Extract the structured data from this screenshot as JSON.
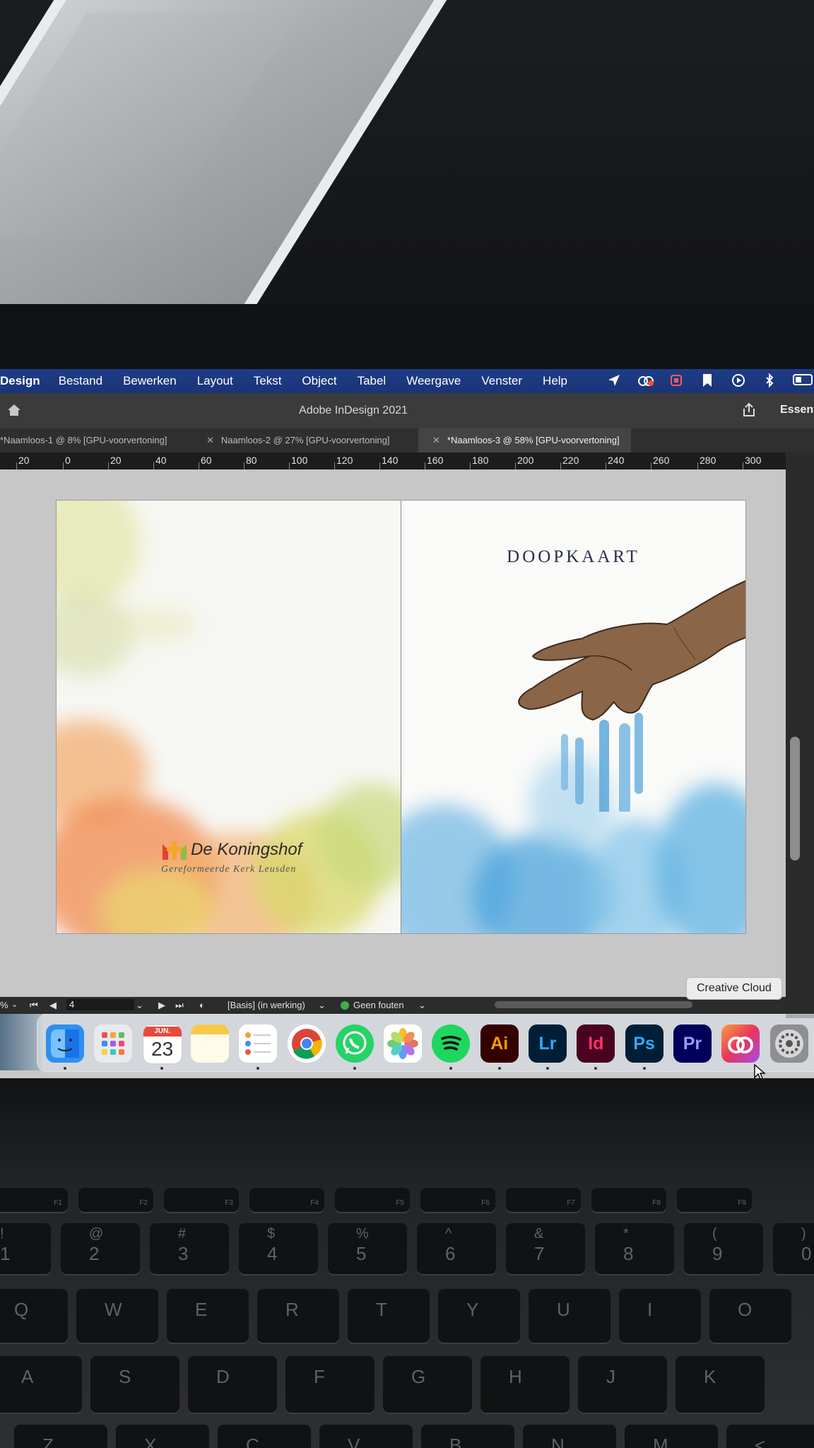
{
  "menubar": {
    "app_name": "Design",
    "items": [
      "Bestand",
      "Bewerken",
      "Layout",
      "Tekst",
      "Object",
      "Tabel",
      "Weergave",
      "Venster",
      "Help"
    ],
    "status_icons": [
      "location-arrow-icon",
      "creative-cloud-status-icon",
      "adobe-updates-icon",
      "bookmark-icon",
      "play-circle-icon",
      "bluetooth-icon",
      "battery-icon"
    ]
  },
  "app_header": {
    "title": "Adobe InDesign 2021",
    "workspace": "Essent"
  },
  "tabs": [
    {
      "label": "*Naamloos-1 @ 8% [GPU-voorvertoning]",
      "active": false
    },
    {
      "label": "Naamloos-2 @ 27% [GPU-voorvertoning]",
      "active": false
    },
    {
      "label": "*Naamloos-3 @ 58% [GPU-voorvertoning]",
      "active": true
    }
  ],
  "ruler": {
    "ticks": [
      "20",
      "0",
      "20",
      "40",
      "60",
      "80",
      "100",
      "120",
      "140",
      "160",
      "180",
      "200",
      "220",
      "240",
      "260",
      "280",
      "300"
    ]
  },
  "document": {
    "right_page_title": "DOOPKAART",
    "logo_name": "De Koningshof",
    "logo_subtitle": "Gereformeerde Kerk Leusden"
  },
  "statusbar": {
    "zoom_suffix": "%",
    "page_number": "4",
    "style": "[Basis] (in werking)",
    "preflight": "Geen fouten"
  },
  "dock": {
    "tooltip": "Creative Cloud",
    "calendar_month": "JUN.",
    "calendar_day": "23",
    "apps": [
      {
        "name": "Finder",
        "glyph": "",
        "bg": "#2f8ff0"
      },
      {
        "name": "Launchpad",
        "glyph": "",
        "bg": "#e9e9ee"
      },
      {
        "name": "Calendar",
        "glyph": "",
        "bg": "#ffffff"
      },
      {
        "name": "Notes",
        "glyph": "",
        "bg": "#fbe7a0"
      },
      {
        "name": "Reminders",
        "glyph": "",
        "bg": "#ffffff"
      },
      {
        "name": "Chrome",
        "glyph": "",
        "bg": "#ffffff"
      },
      {
        "name": "WhatsApp",
        "glyph": "",
        "bg": "#25d366"
      },
      {
        "name": "Photos",
        "glyph": "",
        "bg": "#ffffff"
      },
      {
        "name": "Spotify",
        "glyph": "",
        "bg": "#1ed760"
      },
      {
        "name": "Illustrator",
        "glyph": "Ai",
        "bg": "#330000",
        "fg": "#ff9a00"
      },
      {
        "name": "Lightroom",
        "glyph": "Lr",
        "bg": "#001e36",
        "fg": "#31a8ff"
      },
      {
        "name": "InDesign",
        "glyph": "Id",
        "bg": "#49021f",
        "fg": "#ff3366"
      },
      {
        "name": "Photoshop",
        "glyph": "Ps",
        "bg": "#001e36",
        "fg": "#31a8ff"
      },
      {
        "name": "Premiere Pro",
        "glyph": "Pr",
        "bg": "#00005b",
        "fg": "#9999ff"
      },
      {
        "name": "Creative Cloud",
        "glyph": "",
        "bg": "#e8345a"
      },
      {
        "name": "System Preferences",
        "glyph": "",
        "bg": "#8e8e93"
      }
    ]
  },
  "keyboard": {
    "fn_row": [
      "F1",
      "F2",
      "F3",
      "F4",
      "F5",
      "F6",
      "F7",
      "F8",
      "F9"
    ],
    "number_row": [
      [
        "!",
        "1"
      ],
      [
        "@",
        "2"
      ],
      [
        "#",
        "3"
      ],
      [
        "$",
        "4"
      ],
      [
        "%",
        "5"
      ],
      [
        "^",
        "6"
      ],
      [
        "&",
        "7"
      ],
      [
        "*",
        "8"
      ],
      [
        "(",
        "9"
      ],
      [
        ")",
        "0"
      ]
    ],
    "qwerty_row": [
      "Q",
      "W",
      "E",
      "R",
      "T",
      "Y",
      "U",
      "I",
      "O"
    ],
    "home_row": [
      "A",
      "S",
      "D",
      "F",
      "G",
      "H",
      "J",
      "K"
    ],
    "bottom_row": [
      "Z",
      "X",
      "C",
      "V",
      "B",
      "N",
      "M",
      "<"
    ]
  }
}
